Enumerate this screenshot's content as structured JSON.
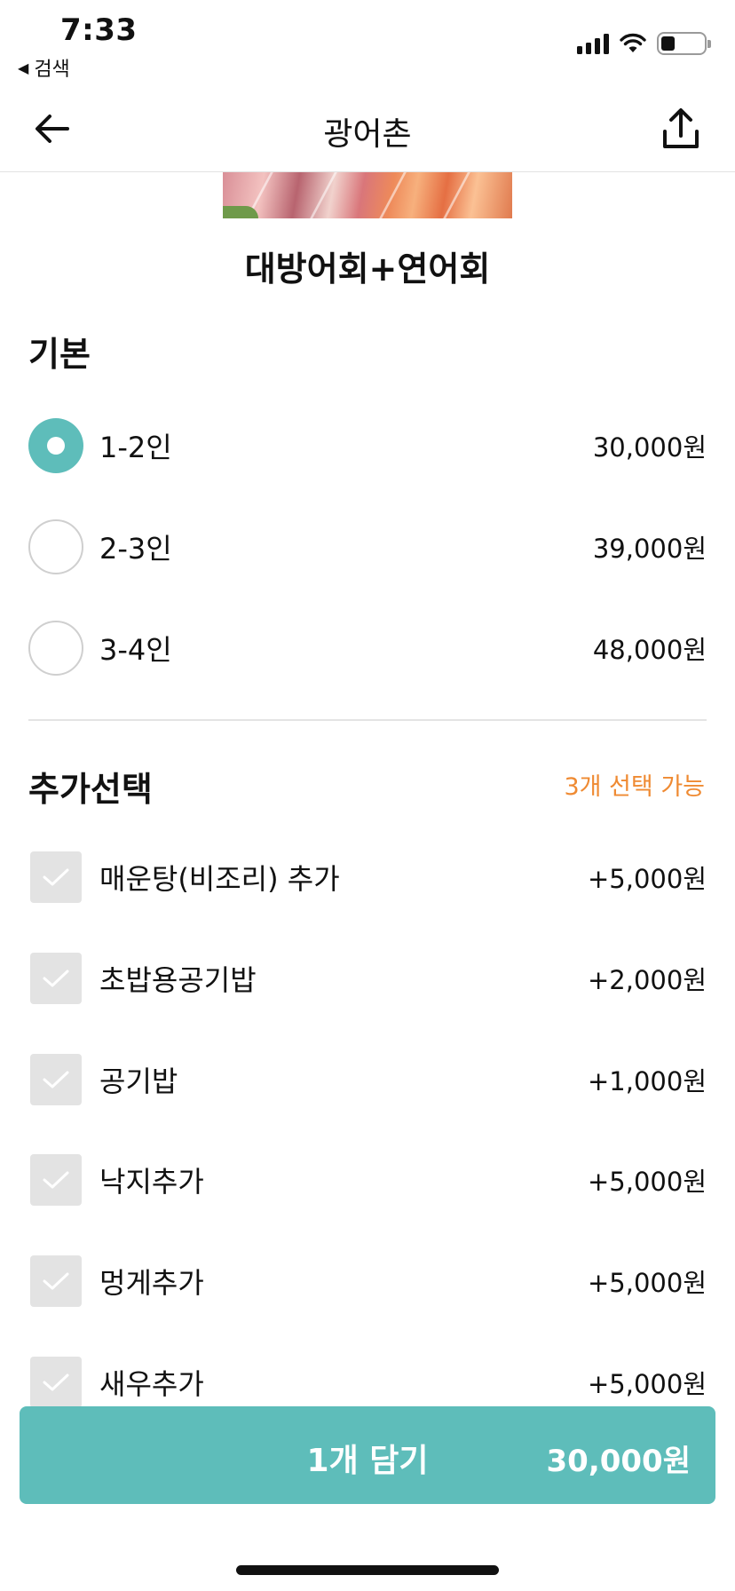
{
  "status_bar": {
    "time": "7:33",
    "back_app": "검색",
    "back_icon": "back-triangle-icon"
  },
  "nav": {
    "title": "광어촌",
    "back_icon": "arrow-left-icon",
    "share_icon": "share-upload-icon"
  },
  "menu": {
    "name": "대방어회+연어회"
  },
  "basic_section": {
    "title": "기본",
    "options": [
      {
        "label": "1-2인",
        "price": "30,000원",
        "selected": true
      },
      {
        "label": "2-3인",
        "price": "39,000원",
        "selected": false
      },
      {
        "label": "3-4인",
        "price": "48,000원",
        "selected": false
      }
    ]
  },
  "extra_section": {
    "title": "추가선택",
    "note": "3개 선택 가능",
    "options": [
      {
        "label": "매운탕(비조리) 추가",
        "price": "+5,000원",
        "checked": false
      },
      {
        "label": "초밥용공기밥",
        "price": "+2,000원",
        "checked": false
      },
      {
        "label": "공기밥",
        "price": "+1,000원",
        "checked": false
      },
      {
        "label": "낙지추가",
        "price": "+5,000원",
        "checked": false
      },
      {
        "label": "멍게추가",
        "price": "+5,000원",
        "checked": false
      },
      {
        "label": "새우추가",
        "price": "+5,000원",
        "checked": false
      }
    ]
  },
  "cta": {
    "label": "1개 담기",
    "price": "30,000원"
  },
  "colors": {
    "accent": "#5ebdba",
    "note": "#ef8a32",
    "checkbox_bg": "#e3e3e3"
  }
}
